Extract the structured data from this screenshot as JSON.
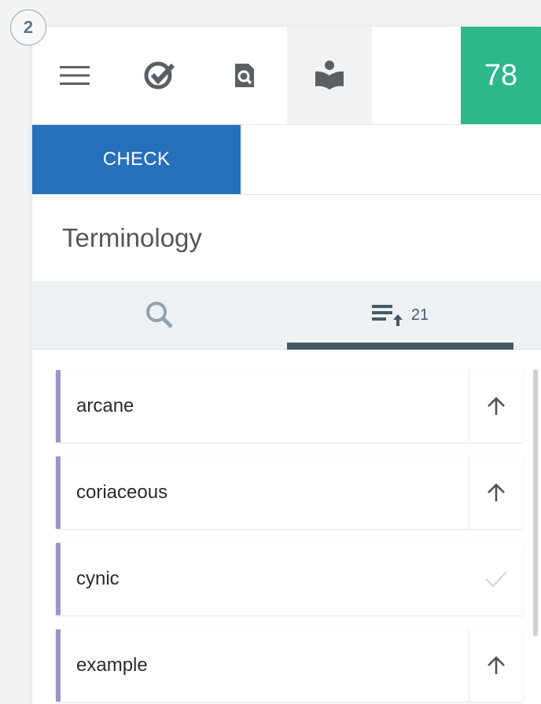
{
  "step": {
    "number": "2"
  },
  "toolbar": {
    "menu_icon": "hamburger-menu-icon",
    "check_icon": "check-circle-icon",
    "search_doc_icon": "document-search-icon",
    "reader_icon": "reading-person-icon",
    "active_index": 3,
    "score": "78",
    "score_color": "#2db88b"
  },
  "check_button": {
    "label": "CHECK",
    "color": "#2670bb"
  },
  "section": {
    "title": "Terminology"
  },
  "tabs": [
    {
      "icon": "search-icon",
      "count": ""
    },
    {
      "icon": "sort-list-up-icon",
      "count": "21",
      "active": true
    }
  ],
  "terms": [
    {
      "label": "arcane",
      "action_icon": "arrow-up-icon"
    },
    {
      "label": "coriaceous",
      "action_icon": "arrow-up-icon"
    },
    {
      "label": "cynic",
      "action_icon": "checkmark-icon"
    },
    {
      "label": "example",
      "action_icon": "arrow-up-icon"
    }
  ],
  "colors": {
    "term_accent": "#9b95c9",
    "tab_active": "#455a64"
  }
}
